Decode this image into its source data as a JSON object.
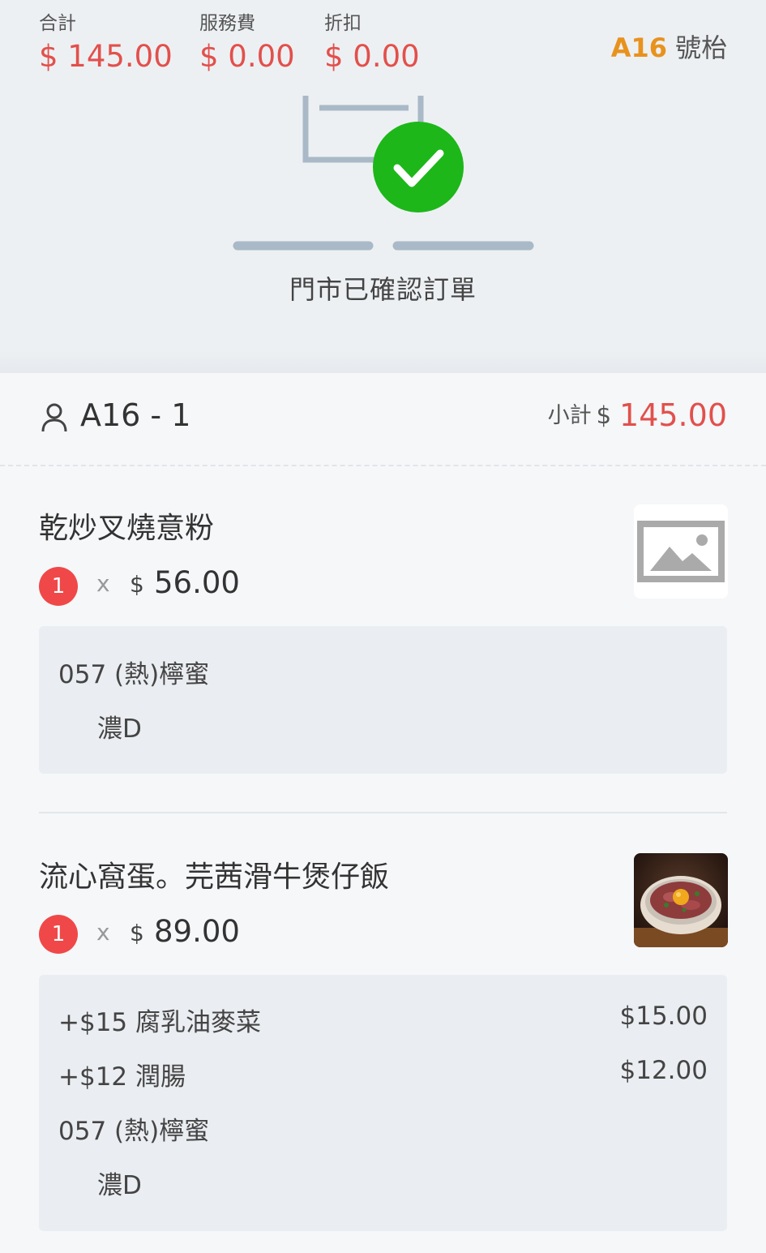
{
  "summary": {
    "total_label": "合計",
    "total_value": "$ 145.00",
    "service_label": "服務費",
    "service_value": "$ 0.00",
    "discount_label": "折扣",
    "discount_value": "$ 0.00"
  },
  "table": {
    "code": "A16",
    "suffix": "號枱"
  },
  "status": {
    "text": "門市已確認訂單"
  },
  "diner": {
    "name": "A16 - 1",
    "subtotal_label": "小計",
    "subtotal_currency": "$",
    "subtotal_value": "145.00"
  },
  "items": [
    {
      "name": "乾炒叉燒意粉",
      "qty": "1",
      "times": "x",
      "currency": "$",
      "price": "56.00",
      "image": "placeholder-image-icon",
      "options": [
        {
          "text": "057 (熱)檸蜜",
          "sub": "濃D"
        }
      ]
    },
    {
      "name": "流心窩蛋。芫茜滑牛煲仔飯",
      "qty": "1",
      "times": "x",
      "currency": "$",
      "price": "89.00",
      "image": "claypot-rice-photo",
      "options": [
        {
          "text": "+$15 腐乳油麥菜",
          "price": "$15.00"
        },
        {
          "text": "+$12 潤腸",
          "price": "$12.00"
        },
        {
          "text": "057 (熱)檸蜜",
          "sub": "濃D"
        }
      ]
    }
  ],
  "colors": {
    "price_red": "#e2504c",
    "table_orange": "#e8921e",
    "check_green": "#1db71a",
    "qty_badge": "#f04848"
  }
}
